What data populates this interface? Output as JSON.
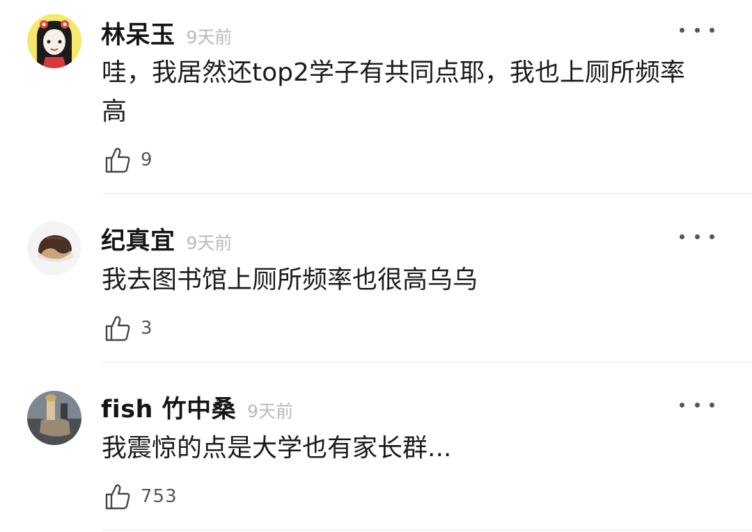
{
  "comments": [
    {
      "username": "林呆玉",
      "time": "9天前",
      "text": "哇，我居然还top2学子有共同点耶，我也上厕所频率高",
      "likes": "9",
      "avatar_icon": "cartoon-girl-avatar",
      "avatar_bg": "#f5e86a"
    },
    {
      "username": "纪真宜",
      "time": "9天前",
      "text": "我去图书馆上厕所频率也很高乌乌",
      "likes": "3",
      "avatar_icon": "chocolate-cookie-avatar",
      "avatar_bg": "#f4f4f4"
    },
    {
      "username": "fish 竹中桑",
      "time": "9天前",
      "text": "我震惊的点是大学也有家长群...",
      "likes": "753",
      "avatar_icon": "photo-avatar",
      "avatar_bg": "#5a6470"
    }
  ],
  "icons": {
    "more": "more-options-icon",
    "like": "thumbs-up-icon"
  }
}
